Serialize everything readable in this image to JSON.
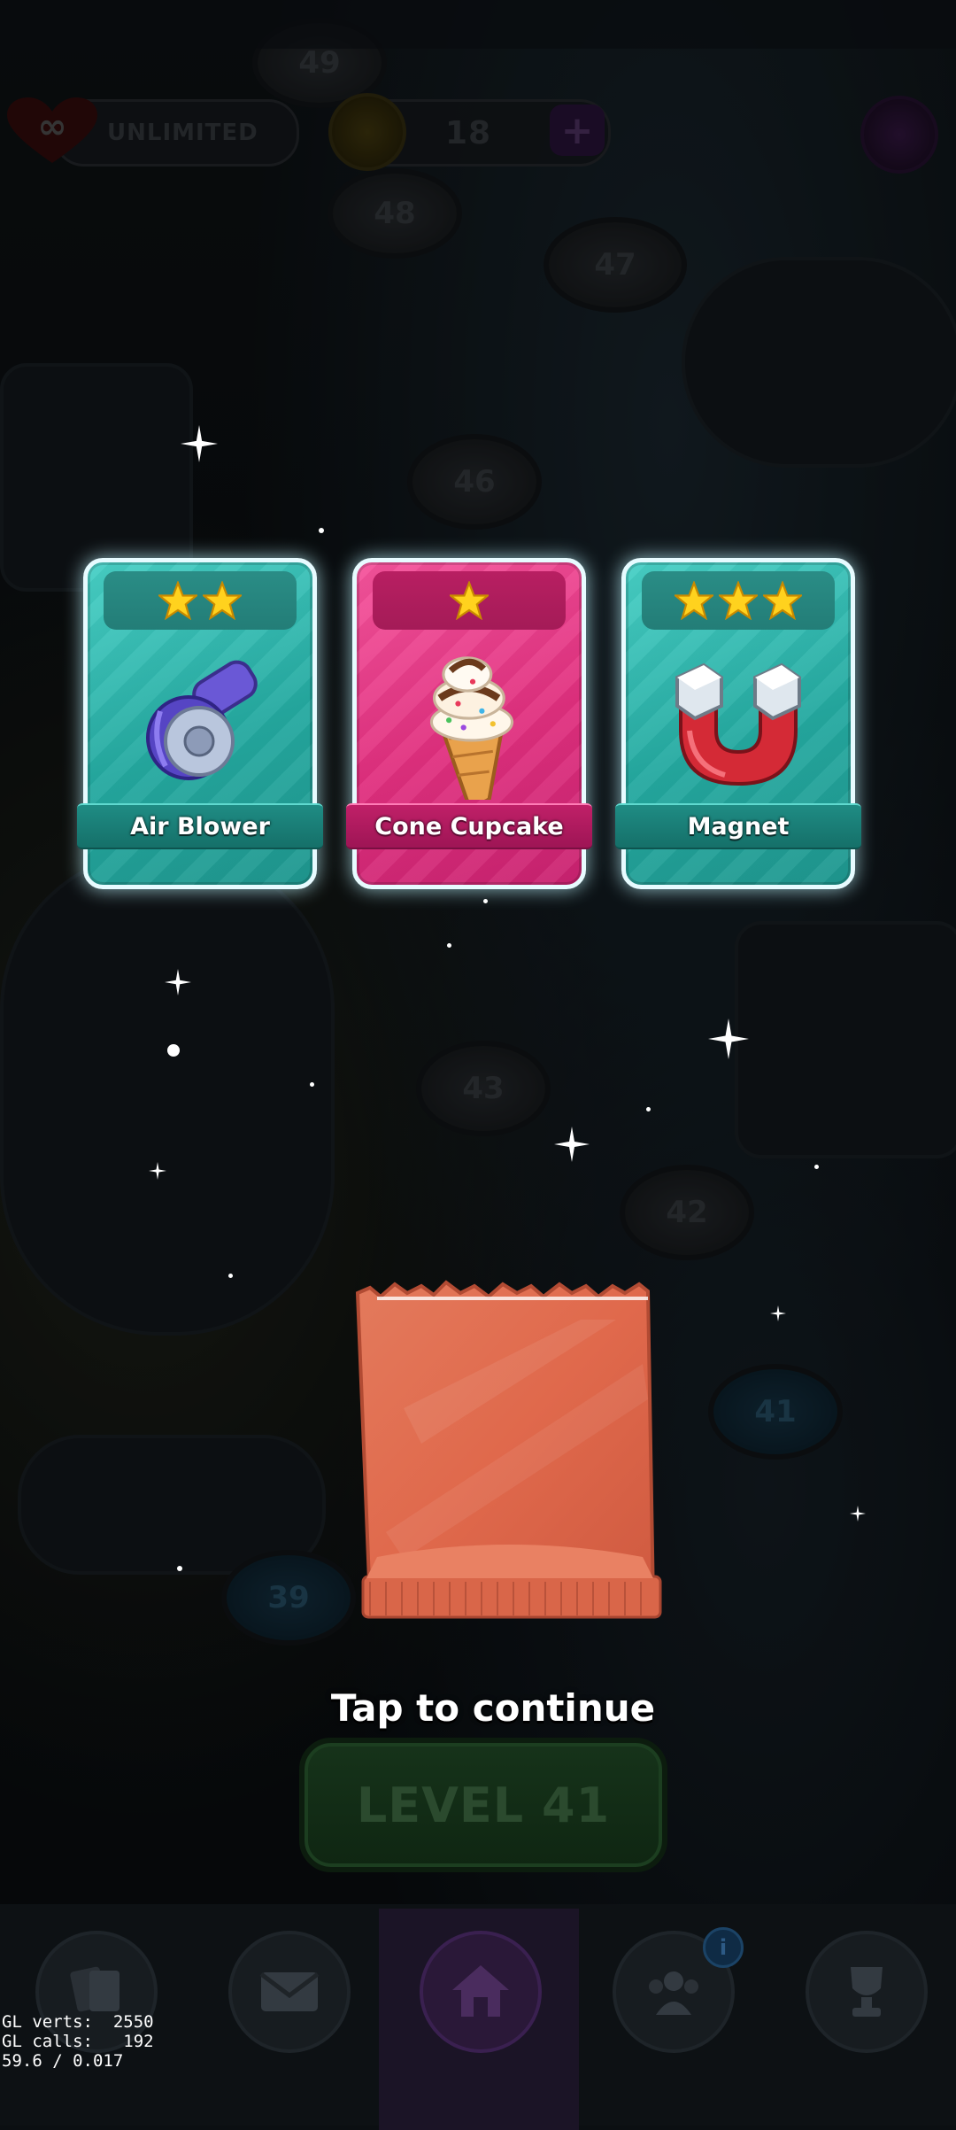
{
  "hud": {
    "lives_label": "UNLIMITED",
    "coins": "18"
  },
  "map": {
    "levels": [
      "49",
      "48",
      "47",
      "46",
      "43",
      "42",
      "41",
      "39"
    ]
  },
  "rewards": [
    {
      "name": "Air Blower",
      "stars": 2,
      "theme": "teal",
      "icon": "air-blower-icon"
    },
    {
      "name": "Cone Cupcake",
      "stars": 1,
      "theme": "pink",
      "icon": "cone-cupcake-icon"
    },
    {
      "name": "Magnet",
      "stars": 3,
      "theme": "teal",
      "icon": "magnet-icon"
    }
  ],
  "prompt": "Tap to continue",
  "level_button": "LEVEL 41",
  "nav": {
    "items": [
      "cards-icon",
      "mail-icon",
      "home-icon",
      "team-icon",
      "trophy-icon"
    ],
    "team_badge": "i"
  },
  "debug": {
    "line1": "GL verts:  2550",
    "line2": "GL calls:   192",
    "line3": "59.6 / 0.017"
  },
  "colors": {
    "card_teal": "#24a9a0",
    "card_pink": "#e02f7e",
    "star": "#ffd21e",
    "bag": "#e0694c"
  }
}
